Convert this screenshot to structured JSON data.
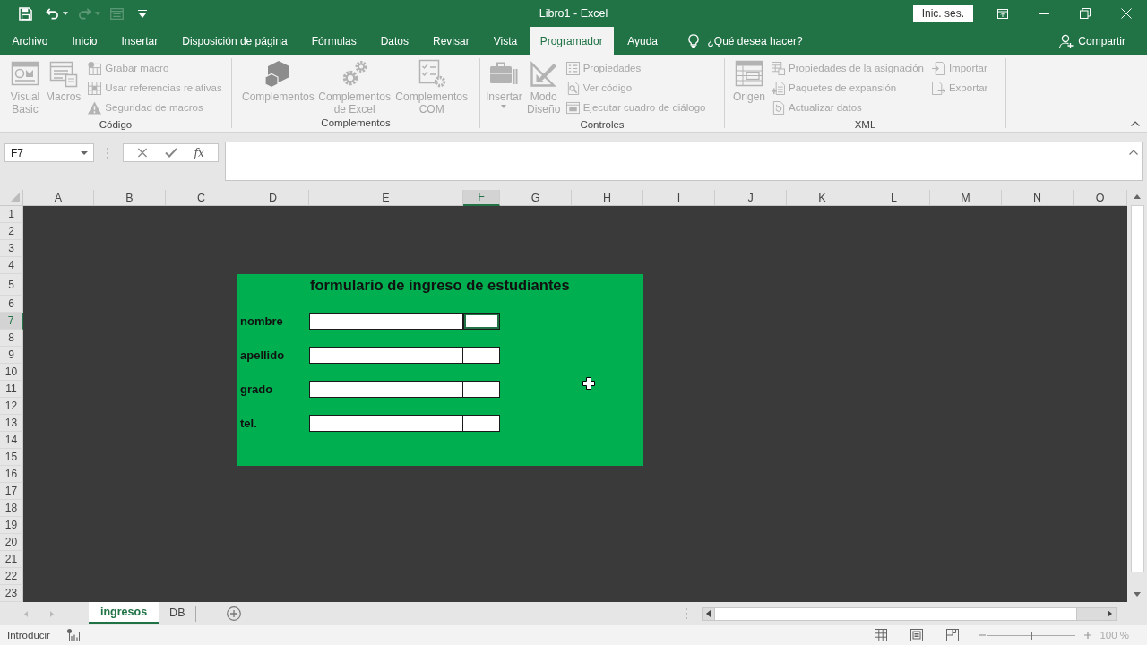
{
  "title_bar": {
    "quick_access": [
      {
        "disabled": false
      },
      {
        "disabled": false
      },
      {
        "disabled": true
      },
      {
        "disabled": true
      }
    ],
    "title": "Libro1 - Excel",
    "sign_in": "Inic. ses."
  },
  "tabs": [
    {
      "label": "Archivo",
      "selected": false
    },
    {
      "label": "Inicio",
      "selected": false
    },
    {
      "label": "Insertar",
      "selected": false
    },
    {
      "label": "Disposición de página",
      "selected": false
    },
    {
      "label": "Fórmulas",
      "selected": false
    },
    {
      "label": "Datos",
      "selected": false
    },
    {
      "label": "Revisar",
      "selected": false
    },
    {
      "label": "Vista",
      "selected": false
    },
    {
      "label": "Programador",
      "selected": true
    },
    {
      "label": "Ayuda",
      "selected": false
    }
  ],
  "tell_me": "¿Qué desea hacer?",
  "share": "Compartir",
  "ribbon": {
    "groups": [
      {
        "label": "Código",
        "large": [
          {
            "label": "Visual Basic",
            "disabled": true,
            "dropdown": false
          },
          {
            "label": "Macros",
            "disabled": true,
            "dropdown": false
          }
        ],
        "small": [
          {
            "label": "Grabar macro",
            "disabled": true
          },
          {
            "label": "Usar referencias relativas",
            "disabled": true
          },
          {
            "label": "Seguridad de macros",
            "disabled": true
          }
        ]
      },
      {
        "label": "Complementos",
        "large": [
          {
            "label": "Complementos",
            "disabled": true,
            "dropdown": false
          },
          {
            "label": "Complementos de Excel",
            "disabled": true,
            "dropdown": false
          },
          {
            "label": "Complementos COM",
            "disabled": true,
            "dropdown": false
          }
        ]
      },
      {
        "label": "Controles",
        "large": [
          {
            "label": "Insertar",
            "disabled": true,
            "dropdown": true
          },
          {
            "label": "Modo Diseño",
            "disabled": true,
            "dropdown": false
          }
        ],
        "small": [
          {
            "label": "Propiedades",
            "disabled": true
          },
          {
            "label": "Ver código",
            "disabled": true
          },
          {
            "label": "Ejecutar cuadro de diálogo",
            "disabled": true
          }
        ]
      },
      {
        "label": "XML",
        "large": [
          {
            "label": "Origen",
            "disabled": true,
            "dropdown": false
          }
        ],
        "small": [
          {
            "label": "Propiedades de la asignación",
            "disabled": true
          },
          {
            "label": "Paquetes de expansión",
            "disabled": true
          },
          {
            "label": "Actualizar datos",
            "disabled": true
          },
          {
            "label": "Importar",
            "disabled": true
          },
          {
            "label": "Exportar",
            "disabled": true
          }
        ]
      }
    ]
  },
  "formula_bar": {
    "name_box": "F7",
    "function_button": "fx"
  },
  "sheet": {
    "columns": [
      {
        "label": "A",
        "selected": false
      },
      {
        "label": "B",
        "selected": false
      },
      {
        "label": "C",
        "selected": false
      },
      {
        "label": "D",
        "selected": false
      },
      {
        "label": "E",
        "selected": false
      },
      {
        "label": "F",
        "selected": true
      },
      {
        "label": "G",
        "selected": false
      },
      {
        "label": "H",
        "selected": false
      },
      {
        "label": "I",
        "selected": false
      },
      {
        "label": "J",
        "selected": false
      },
      {
        "label": "K",
        "selected": false
      },
      {
        "label": "L",
        "selected": false
      },
      {
        "label": "M",
        "selected": false
      },
      {
        "label": "N",
        "selected": false
      },
      {
        "label": "O",
        "selected": false
      }
    ],
    "rows": [
      {
        "label": "1",
        "selected": false
      },
      {
        "label": "2",
        "selected": false
      },
      {
        "label": "3",
        "selected": false
      },
      {
        "label": "4",
        "selected": false
      },
      {
        "label": "5",
        "selected": false
      },
      {
        "label": "6",
        "selected": false
      },
      {
        "label": "7",
        "selected": true
      },
      {
        "label": "8",
        "selected": false
      },
      {
        "label": "9",
        "selected": false
      },
      {
        "label": "10",
        "selected": false
      },
      {
        "label": "11",
        "selected": false
      },
      {
        "label": "12",
        "selected": false
      },
      {
        "label": "13",
        "selected": false
      },
      {
        "label": "14",
        "selected": false
      },
      {
        "label": "15",
        "selected": false
      },
      {
        "label": "16",
        "selected": false
      },
      {
        "label": "17",
        "selected": false
      },
      {
        "label": "18",
        "selected": false
      },
      {
        "label": "19",
        "selected": false
      },
      {
        "label": "20",
        "selected": false
      },
      {
        "label": "21",
        "selected": false
      },
      {
        "label": "22",
        "selected": false
      },
      {
        "label": "23",
        "selected": false
      }
    ],
    "form": {
      "title": "formulario de ingreso de estudiantes",
      "fields": [
        {
          "label": "nombre",
          "cells": [
            {
              "selected": false
            },
            {
              "selected": true
            }
          ]
        },
        {
          "label": "apellido",
          "cells": [
            {
              "selected": false
            },
            {
              "selected": false
            }
          ]
        },
        {
          "label": "grado",
          "cells": [
            {
              "selected": false
            },
            {
              "selected": false
            }
          ]
        },
        {
          "label": "tel.",
          "cells": [
            {
              "selected": false
            },
            {
              "selected": false
            }
          ]
        }
      ]
    }
  },
  "sheet_tabs": [
    {
      "label": "ingresos",
      "selected": true
    },
    {
      "label": "DB",
      "selected": false
    }
  ],
  "status_bar": {
    "mode": "Introducir",
    "zoom": {
      "level": 0.5,
      "reading": "100 %"
    }
  }
}
